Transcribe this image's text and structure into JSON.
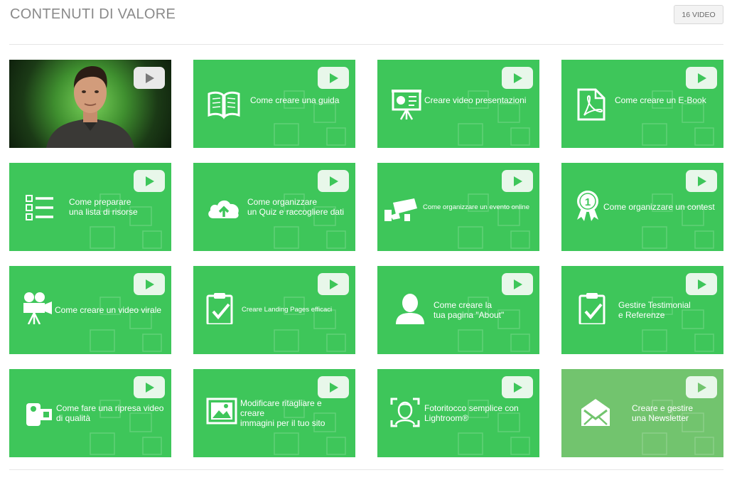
{
  "header": {
    "title": "CONTENUTI DI VALORE",
    "badge": "16 VIDEO"
  },
  "tiles": [
    {
      "type": "photo",
      "label": "",
      "icon": "presenter-photo"
    },
    {
      "label": "Come creare una guida",
      "icon": "book-icon"
    },
    {
      "label": "Creare video presentazioni",
      "icon": "presentation-board-icon"
    },
    {
      "label": "Come creare un E-Book",
      "icon": "pdf-icon"
    },
    {
      "label": "Come preparare\nuna lista di risorse",
      "icon": "checklist-icon"
    },
    {
      "label": "Come organizzare\nun Quiz e raccogliere dati",
      "icon": "cloud-upload-icon"
    },
    {
      "label": "Come organizzare un evento online",
      "icon": "security-camera-icon"
    },
    {
      "label": "Come organizzare un contest",
      "icon": "award-ribbon-icon"
    },
    {
      "label": "Come creare un video virale",
      "icon": "film-camera-icon"
    },
    {
      "label": "Creare Landing Pages efficaci",
      "icon": "clipboard-check-icon"
    },
    {
      "label": "Come creare la\ntua pagina \"About\"",
      "icon": "user-icon"
    },
    {
      "label": "Gestire Testimonial\ne Referenze",
      "icon": "clipboard-check-icon"
    },
    {
      "label": "Come fare una ripresa video\ndi qualità",
      "icon": "camcorder-icon"
    },
    {
      "label": "Modificare ritagliare e creare\nimmagini per il tuo sito",
      "icon": "image-icon"
    },
    {
      "label": "Fotoritocco semplice con\nLightroom®",
      "icon": "face-scan-icon"
    },
    {
      "label": "Creare e gestire\nuna Newsletter",
      "icon": "envelope-icon"
    }
  ],
  "colors": {
    "tile_green": "#3ec65a",
    "tile_green_faded": "#72c46e",
    "title_gray": "#8a8a8a"
  }
}
